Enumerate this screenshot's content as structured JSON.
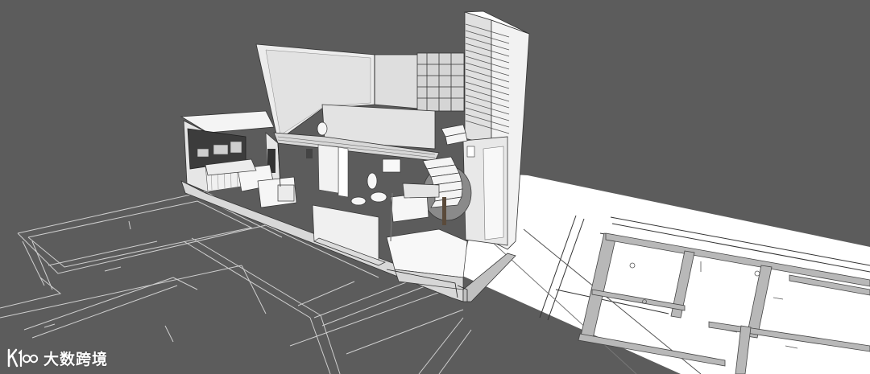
{
  "scene": {
    "background_color": "#5c5c5c",
    "paper_color": "#ffffff",
    "model_color": "#eeeeee",
    "line_color": "#333333"
  },
  "watermark": {
    "logo_text": "K100",
    "brand_text": "大数跨境"
  }
}
